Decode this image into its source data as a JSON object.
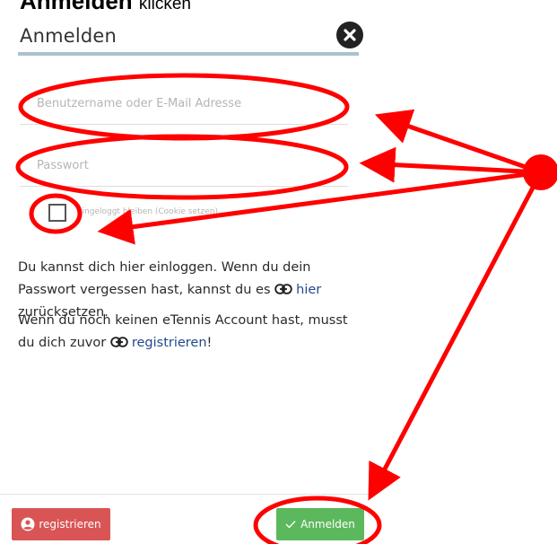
{
  "instruction": {
    "bold_text": "Anmelden",
    "rest_text": "klicken"
  },
  "dialog": {
    "title": "Anmelden",
    "username": {
      "value": "",
      "placeholder": "Benutzername oder E-Mail Adresse"
    },
    "password": {
      "value": "",
      "placeholder": "Passwort"
    },
    "remember": {
      "checked": false,
      "label": "eingeloggt bleiben (Cookie setzen)"
    },
    "help1": {
      "text_before": "Du kannst dich hier einloggen. Wenn du dein Passwort vergessen hast, kannst du es",
      "link": "hier",
      "text_after": "zurücksetzen."
    },
    "help2": {
      "text_before": "Wenn du noch keinen eTennis Account hast, musst du dich zuvor",
      "link": "registrieren",
      "text_after": "!"
    }
  },
  "footer": {
    "register_label": "registrieren",
    "login_label": "Anmelden"
  },
  "colors": {
    "title_rule": "#a9c3cc",
    "register_button": "#d95555",
    "login_button": "#5cb85c",
    "link": "#234a8a",
    "annotation": "#ff0000"
  },
  "icons": [
    "close-icon",
    "link-icon",
    "user-circle-icon",
    "checkmark-icon"
  ]
}
